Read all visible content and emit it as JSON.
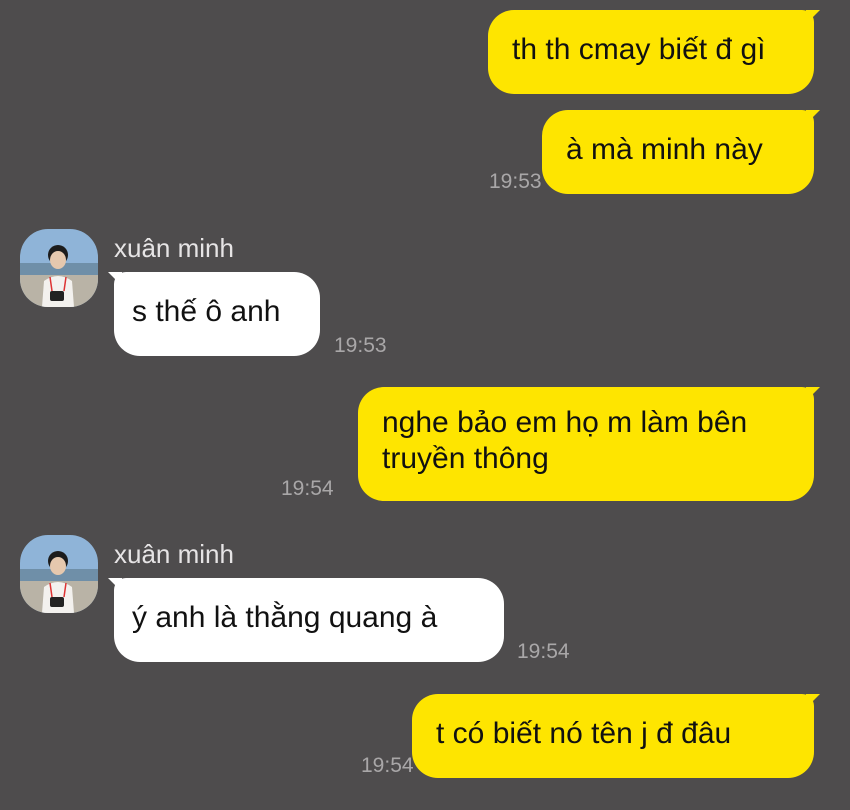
{
  "colors": {
    "background": "#4e4c4d",
    "outgoing_bubble": "#fee500",
    "incoming_bubble": "#ffffff",
    "timestamp": "#a9a7a8",
    "sender_name": "#e6e4e5"
  },
  "messages": [
    {
      "direction": "outgoing",
      "text": "th th cmay biết đ gì",
      "time": ""
    },
    {
      "direction": "outgoing",
      "text": "à mà minh này",
      "time": "19:53"
    },
    {
      "direction": "incoming",
      "sender": "xuân minh",
      "avatar": "profile-photo",
      "text": "s thế ô anh",
      "time": "19:53"
    },
    {
      "direction": "outgoing",
      "text": "nghe bảo em họ m làm bên truyền thông",
      "time": "19:54"
    },
    {
      "direction": "incoming",
      "sender": "xuân minh",
      "avatar": "profile-photo",
      "text": "ý anh là thằng quang à",
      "time": "19:54"
    },
    {
      "direction": "outgoing",
      "text": "t có biết nó tên j đ đâu",
      "time": "19:54"
    }
  ]
}
